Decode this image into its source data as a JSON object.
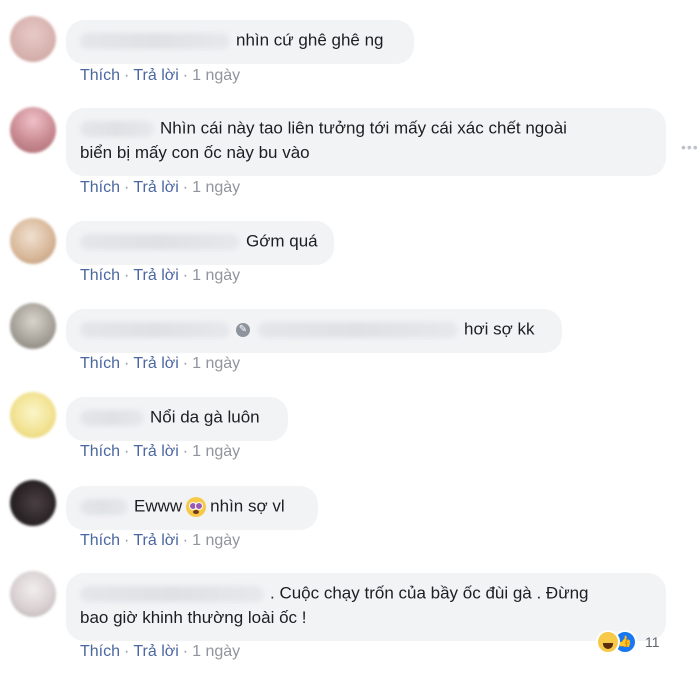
{
  "actions": {
    "like": "Thích",
    "reply": "Trả lời",
    "sep": "·",
    "time": "1 ngày"
  },
  "comments": [
    {
      "text": "nhìn cứ ghê ghê ng"
    },
    {
      "text_line1": "Nhìn cái này tao liên tưởng tới mấy cái xác chết ngoài",
      "text_line2": "biển bị mấy con ốc này bu vào"
    },
    {
      "text": "Gớm quá"
    },
    {
      "text": "hơi sợ kk"
    },
    {
      "text": "Nổi da gà luôn"
    },
    {
      "text_before": "Ewww",
      "text_after": "nhìn sợ vl"
    },
    {
      "text_line1": ". Cuộc chạy trốn của bầy ốc đùi gà . Đừng",
      "text_line2": "bao giờ khinh thường loài ốc !"
    }
  ],
  "reactions": {
    "count": "11",
    "icons": [
      "haha-icon",
      "like-icon"
    ]
  },
  "more_icon": "more-horizontal-icon"
}
